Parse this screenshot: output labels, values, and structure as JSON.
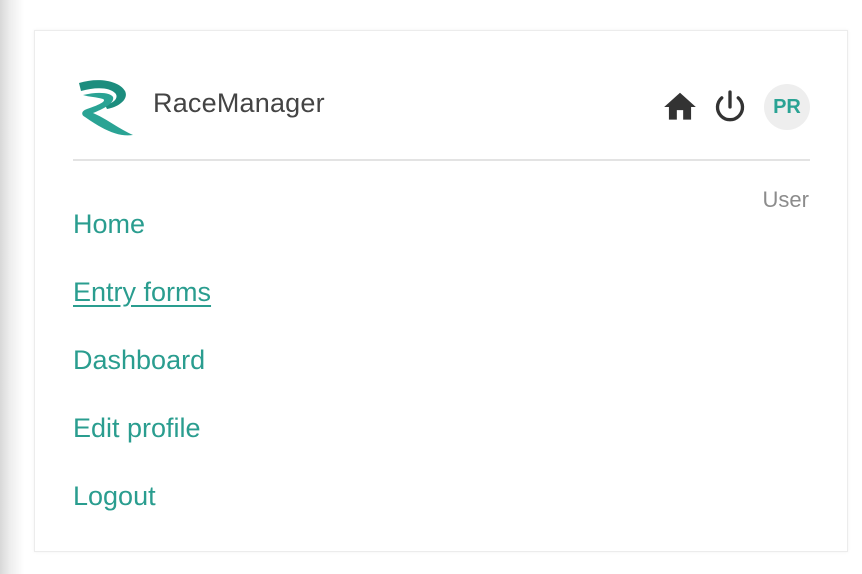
{
  "header": {
    "brand": "RaceManager",
    "avatar_initials": "PR",
    "icons": {
      "logo": "racemanager-logo",
      "home": "home-icon",
      "power": "power-icon"
    }
  },
  "user": {
    "role": "User"
  },
  "nav": {
    "items": [
      {
        "label": "Home",
        "active": false
      },
      {
        "label": "Entry forms",
        "active": true
      },
      {
        "label": "Dashboard",
        "active": false
      },
      {
        "label": "Edit profile",
        "active": false
      },
      {
        "label": "Logout",
        "active": false
      }
    ]
  },
  "colors": {
    "accent": "#2a9d8f",
    "text_primary": "#444444",
    "text_muted": "#8c8c8c",
    "icon": "#333333",
    "avatar_bg": "#eeeeee"
  }
}
